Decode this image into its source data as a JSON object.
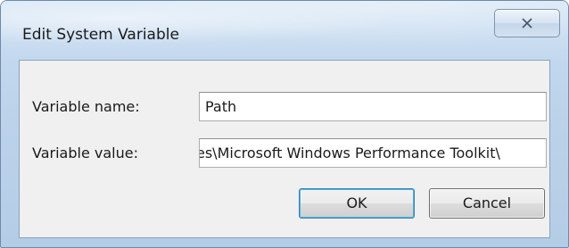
{
  "window": {
    "title": "Edit System Variable",
    "close_icon": "close-icon"
  },
  "form": {
    "name_label": "Variable name:",
    "name_value": "Path",
    "value_label": "Variable value:",
    "value_value": "es\\Microsoft Windows Performance Toolkit\\"
  },
  "buttons": {
    "ok_label": "OK",
    "cancel_label": "Cancel"
  }
}
